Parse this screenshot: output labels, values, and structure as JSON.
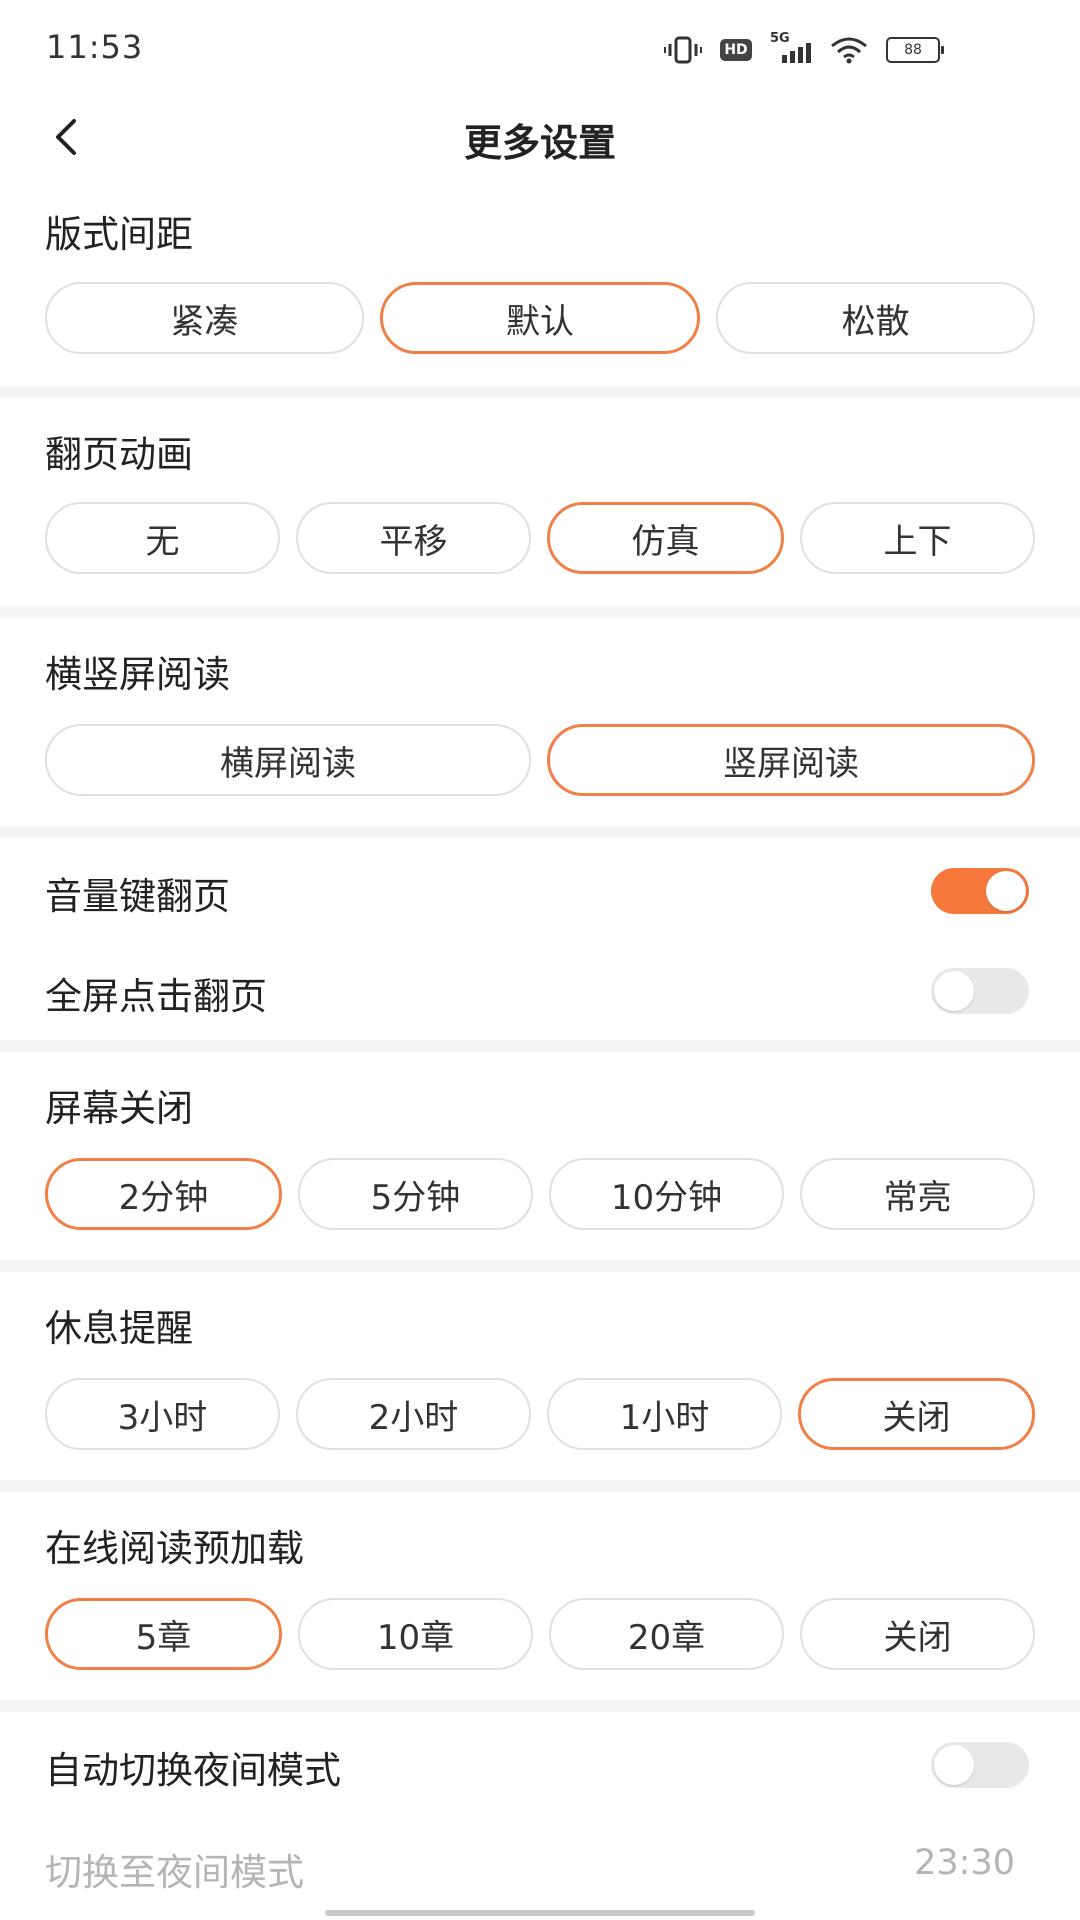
{
  "status_bar": {
    "time": "11:53",
    "network": "5G",
    "hd": "HD",
    "battery": "88",
    "icons": [
      "vibrate-icon",
      "hd-icon",
      "5g-signal-icon",
      "wifi-icon",
      "battery-icon"
    ]
  },
  "header": {
    "title": "更多设置",
    "back_icon": "chevron-left-icon"
  },
  "layout_spacing": {
    "title": "版式间距",
    "options": [
      "紧凑",
      "默认",
      "松散"
    ],
    "selected": "默认"
  },
  "page_animation": {
    "title": "翻页动画",
    "options": [
      "无",
      "平移",
      "仿真",
      "上下"
    ],
    "selected": "仿真"
  },
  "orientation": {
    "title": "横竖屏阅读",
    "options": [
      "横屏阅读",
      "竖屏阅读"
    ],
    "selected": "竖屏阅读"
  },
  "volume_key_page": {
    "label": "音量键翻页",
    "on": true
  },
  "fullscreen_tap_page": {
    "label": "全屏点击翻页",
    "on": false
  },
  "screen_off": {
    "title": "屏幕关闭",
    "options": [
      "2分钟",
      "5分钟",
      "10分钟",
      "常亮"
    ],
    "selected": "2分钟"
  },
  "rest_reminder": {
    "title": "休息提醒",
    "options": [
      "3小时",
      "2小时",
      "1小时",
      "关闭"
    ],
    "selected": "关闭"
  },
  "preload": {
    "title": "在线阅读预加载",
    "options": [
      "5章",
      "10章",
      "20章",
      "关闭"
    ],
    "selected": "5章"
  },
  "auto_night_mode": {
    "label": "自动切换夜间模式",
    "on": false
  },
  "night_mode_time": {
    "label": "切换至夜间模式",
    "value": "23:30"
  },
  "colors": {
    "accent": "#f08045",
    "toggle_on": "#f5783c",
    "divider": "#f5f5f5",
    "disabled_text": "#b5b5b5"
  }
}
